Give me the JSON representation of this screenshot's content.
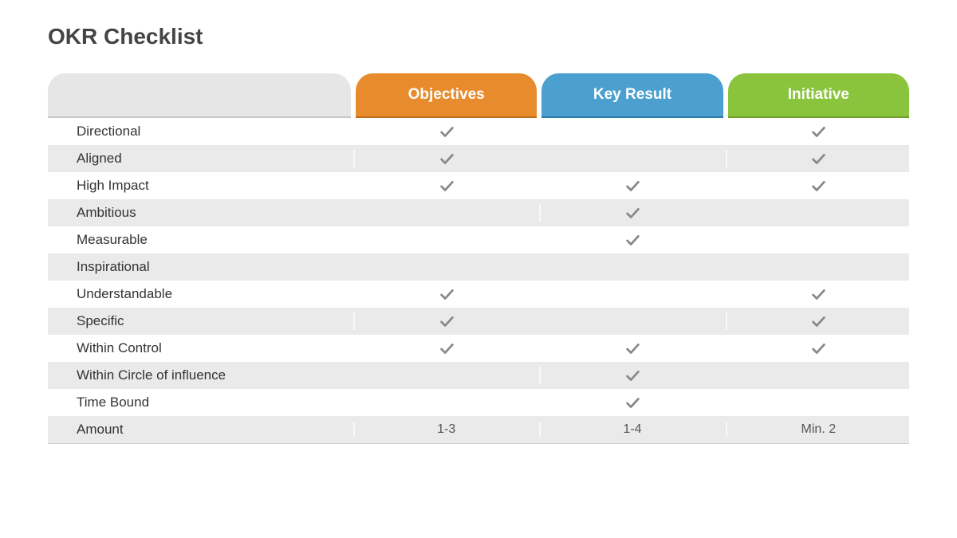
{
  "title": "OKR Checklist",
  "columns": {
    "objectives": "Objectives",
    "keyresult": "Key Result",
    "initiative": "Initiative"
  },
  "rows": [
    {
      "label": "Directional",
      "objectives": "check",
      "keyresult": "",
      "initiative": "check"
    },
    {
      "label": "Aligned",
      "objectives": "check",
      "keyresult": "",
      "initiative": "check"
    },
    {
      "label": "High Impact",
      "objectives": "check",
      "keyresult": "check",
      "initiative": "check"
    },
    {
      "label": "Ambitious",
      "objectives": "",
      "keyresult": "check",
      "initiative": ""
    },
    {
      "label": "Measurable",
      "objectives": "",
      "keyresult": "check",
      "initiative": ""
    },
    {
      "label": "Inspirational",
      "objectives": "",
      "keyresult": "",
      "initiative": ""
    },
    {
      "label": "Understandable",
      "objectives": "check",
      "keyresult": "",
      "initiative": "check"
    },
    {
      "label": "Specific",
      "objectives": "check",
      "keyresult": "",
      "initiative": "check"
    },
    {
      "label": "Within Control",
      "objectives": "check",
      "keyresult": "check",
      "initiative": "check"
    },
    {
      "label": "Within Circle of influence",
      "objectives": "",
      "keyresult": "check",
      "initiative": ""
    },
    {
      "label": "Time Bound",
      "objectives": "",
      "keyresult": "check",
      "initiative": ""
    },
    {
      "label": "Amount",
      "objectives": "1-3",
      "keyresult": "1-4",
      "initiative": "Min. 2"
    }
  ]
}
